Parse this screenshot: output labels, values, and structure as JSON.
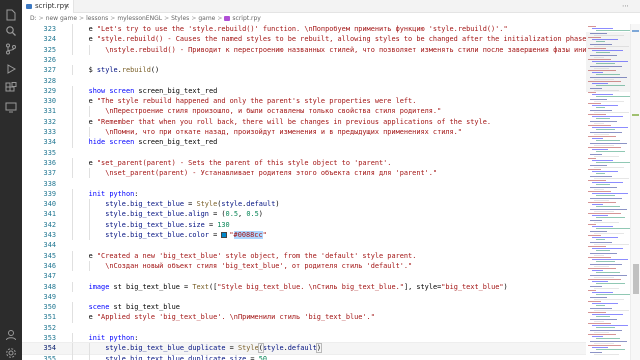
{
  "tab": {
    "label": "script.rpy",
    "close": "×"
  },
  "tab_actions": "⋯",
  "breadcrumb": [
    "D:",
    "new game",
    "lessons",
    "mylessonENGL",
    "Styles",
    "game",
    "script.rpy"
  ],
  "breadcrumb_sep": ">",
  "lines": [
    {
      "n": "323",
      "indent": 1,
      "tokens": [
        [
          "plain",
          "e "
        ],
        [
          "str",
          "\"Let's try to use the 'style.rebuild()' function. \\nПопробуем применить функцию 'style.rebuild()'.\""
        ]
      ]
    },
    {
      "n": "324",
      "indent": 1,
      "tokens": [
        [
          "plain",
          "e "
        ],
        [
          "str",
          "\"style.rebuild() - Causes the named styles to be rebuilt, allowing styles to be changed after the initialization phase has com"
        ]
      ]
    },
    {
      "n": "325",
      "indent": 2,
      "tokens": [
        [
          "str",
          "\\nstyle.rebuild() - Приводит к перестроению названных стилей, что позволяет изменять стили после завершения фазы инициализац"
        ]
      ]
    },
    {
      "n": "326",
      "indent": 0,
      "tokens": []
    },
    {
      "n": "327",
      "indent": 1,
      "tokens": [
        [
          "plain",
          "$ "
        ],
        [
          "var",
          "style"
        ],
        [
          "plain",
          "."
        ],
        [
          "fn",
          "rebuild"
        ],
        [
          "plain",
          "()"
        ]
      ]
    },
    {
      "n": "328",
      "indent": 0,
      "tokens": []
    },
    {
      "n": "329",
      "indent": 1,
      "tokens": [
        [
          "kw",
          "show"
        ],
        [
          "plain",
          " "
        ],
        [
          "kw",
          "screen"
        ],
        [
          "plain",
          " screen_big_text_red"
        ]
      ]
    },
    {
      "n": "330",
      "indent": 1,
      "tokens": [
        [
          "plain",
          "e "
        ],
        [
          "str",
          "\"The style rebuild happened and only the parent's style properties were left."
        ]
      ]
    },
    {
      "n": "331",
      "indent": 2,
      "tokens": [
        [
          "str",
          "\\nПерестроение стиля произошло, и были оставлены только свойства стиля родителя.\""
        ]
      ]
    },
    {
      "n": "332",
      "indent": 1,
      "tokens": [
        [
          "plain",
          "e "
        ],
        [
          "str",
          "\"Remember that when you roll back, there will be changes in previous applications of the style."
        ]
      ]
    },
    {
      "n": "333",
      "indent": 2,
      "tokens": [
        [
          "str",
          "\\nПомни, что при откате назад, произойдут изменения и в предыдущих применениях стиля.\""
        ]
      ]
    },
    {
      "n": "334",
      "indent": 1,
      "tokens": [
        [
          "kw",
          "hide"
        ],
        [
          "plain",
          " "
        ],
        [
          "kw",
          "screen"
        ],
        [
          "plain",
          " screen_big_text_red"
        ]
      ]
    },
    {
      "n": "335",
      "indent": 0,
      "tokens": []
    },
    {
      "n": "336",
      "indent": 1,
      "tokens": [
        [
          "plain",
          "e "
        ],
        [
          "str",
          "\"set_parent(parent) - Sets the parent of this style object to 'parent'."
        ]
      ]
    },
    {
      "n": "337",
      "indent": 2,
      "tokens": [
        [
          "str",
          "\\nset_parent(parent) - Устанавливает родителя этого объекта стиля для 'parent'.\""
        ]
      ]
    },
    {
      "n": "338",
      "indent": 0,
      "tokens": []
    },
    {
      "n": "339",
      "indent": 1,
      "tokens": [
        [
          "kw",
          "init"
        ],
        [
          "plain",
          " "
        ],
        [
          "kw",
          "python"
        ],
        [
          "plain",
          ":"
        ]
      ]
    },
    {
      "n": "340",
      "indent": 2,
      "tokens": [
        [
          "var",
          "style"
        ],
        [
          "plain",
          "."
        ],
        [
          "var",
          "big_text_blue"
        ],
        [
          "plain",
          " = "
        ],
        [
          "fn",
          "Style"
        ],
        [
          "plain",
          "("
        ],
        [
          "var",
          "style"
        ],
        [
          "plain",
          "."
        ],
        [
          "var",
          "default"
        ],
        [
          "plain",
          ")"
        ]
      ]
    },
    {
      "n": "341",
      "indent": 2,
      "tokens": [
        [
          "var",
          "style"
        ],
        [
          "plain",
          "."
        ],
        [
          "var",
          "big_text_blue"
        ],
        [
          "plain",
          "."
        ],
        [
          "var",
          "align"
        ],
        [
          "plain",
          " = ("
        ],
        [
          "num",
          "0.5"
        ],
        [
          "plain",
          ", "
        ],
        [
          "num",
          "0.5"
        ],
        [
          "plain",
          ")"
        ]
      ]
    },
    {
      "n": "342",
      "indent": 2,
      "tokens": [
        [
          "var",
          "style"
        ],
        [
          "plain",
          "."
        ],
        [
          "var",
          "big_text_blue"
        ],
        [
          "plain",
          "."
        ],
        [
          "var",
          "size"
        ],
        [
          "plain",
          " = "
        ],
        [
          "num",
          "130"
        ]
      ]
    },
    {
      "n": "343",
      "indent": 2,
      "tokens": [
        [
          "var",
          "style"
        ],
        [
          "plain",
          "."
        ],
        [
          "var",
          "big_text_blue"
        ],
        [
          "plain",
          "."
        ],
        [
          "var",
          "color"
        ],
        [
          "plain",
          " = "
        ],
        [
          "swatch",
          ""
        ],
        [
          "str",
          "\""
        ],
        [
          "sel",
          "#0088cc"
        ],
        [
          "str",
          "\""
        ]
      ]
    },
    {
      "n": "344",
      "indent": 0,
      "tokens": []
    },
    {
      "n": "345",
      "indent": 1,
      "tokens": [
        [
          "plain",
          "e "
        ],
        [
          "str",
          "\"Created a new 'big_text_blue' style object, from the 'default' style parent."
        ]
      ]
    },
    {
      "n": "346",
      "indent": 2,
      "tokens": [
        [
          "str",
          "\\nСоздан новый объект стиля 'big_text_blue', от родителя стиль 'default'.\""
        ]
      ]
    },
    {
      "n": "347",
      "indent": 0,
      "tokens": []
    },
    {
      "n": "348",
      "indent": 1,
      "tokens": [
        [
          "kw",
          "image"
        ],
        [
          "plain",
          " st big_text_blue = "
        ],
        [
          "fn",
          "Text"
        ],
        [
          "plain",
          "(["
        ],
        [
          "str",
          "\"Style big_text_blue. \\nСтиль big_text_blue.\""
        ],
        [
          "plain",
          "], style="
        ],
        [
          "str",
          "\"big_text_blue\""
        ],
        [
          "plain",
          ")"
        ]
      ]
    },
    {
      "n": "349",
      "indent": 0,
      "tokens": []
    },
    {
      "n": "350",
      "indent": 1,
      "tokens": [
        [
          "kw",
          "scene"
        ],
        [
          "plain",
          " st big_text_blue"
        ]
      ]
    },
    {
      "n": "351",
      "indent": 1,
      "tokens": [
        [
          "plain",
          "e "
        ],
        [
          "str",
          "\"Applied style 'big_text_blue'. \\nПрименили стиль 'big_text_blue'.\""
        ]
      ]
    },
    {
      "n": "352",
      "indent": 0,
      "tokens": []
    },
    {
      "n": "353",
      "indent": 1,
      "tokens": [
        [
          "kw",
          "init"
        ],
        [
          "plain",
          " "
        ],
        [
          "kw",
          "python"
        ],
        [
          "plain",
          ":"
        ]
      ]
    },
    {
      "n": "354",
      "indent": 2,
      "current": true,
      "tokens": [
        [
          "var",
          "style"
        ],
        [
          "plain",
          "."
        ],
        [
          "var",
          "big_text_blue_duplicate"
        ],
        [
          "plain",
          " = "
        ],
        [
          "fn",
          "Style"
        ],
        [
          "bracket",
          "("
        ],
        [
          "var",
          "style"
        ],
        [
          "plain",
          "."
        ],
        [
          "var",
          "default"
        ],
        [
          "bracket",
          ")"
        ],
        [
          "cursor",
          ""
        ]
      ]
    },
    {
      "n": "355",
      "indent": 2,
      "tokens": [
        [
          "var",
          "style"
        ],
        [
          "plain",
          "."
        ],
        [
          "var",
          "big_text_blue_duplicate"
        ],
        [
          "plain",
          "."
        ],
        [
          "var",
          "size"
        ],
        [
          "plain",
          " = "
        ],
        [
          "num",
          "50"
        ]
      ]
    },
    {
      "n": "356",
      "indent": 0,
      "tokens": []
    }
  ],
  "colors": {
    "keyword": "#0000ff",
    "string": "#a31515",
    "function": "#795e26",
    "variable": "#001080",
    "number": "#098658",
    "line_number": "#237893",
    "swatch": "#0088cc",
    "activity_bar": "#2c2c2c"
  },
  "icons": [
    "explorer-icon",
    "search-icon",
    "source-control-icon",
    "run-debug-icon",
    "extensions-icon",
    "remote-icon",
    "account-icon",
    "settings-gear-icon"
  ]
}
